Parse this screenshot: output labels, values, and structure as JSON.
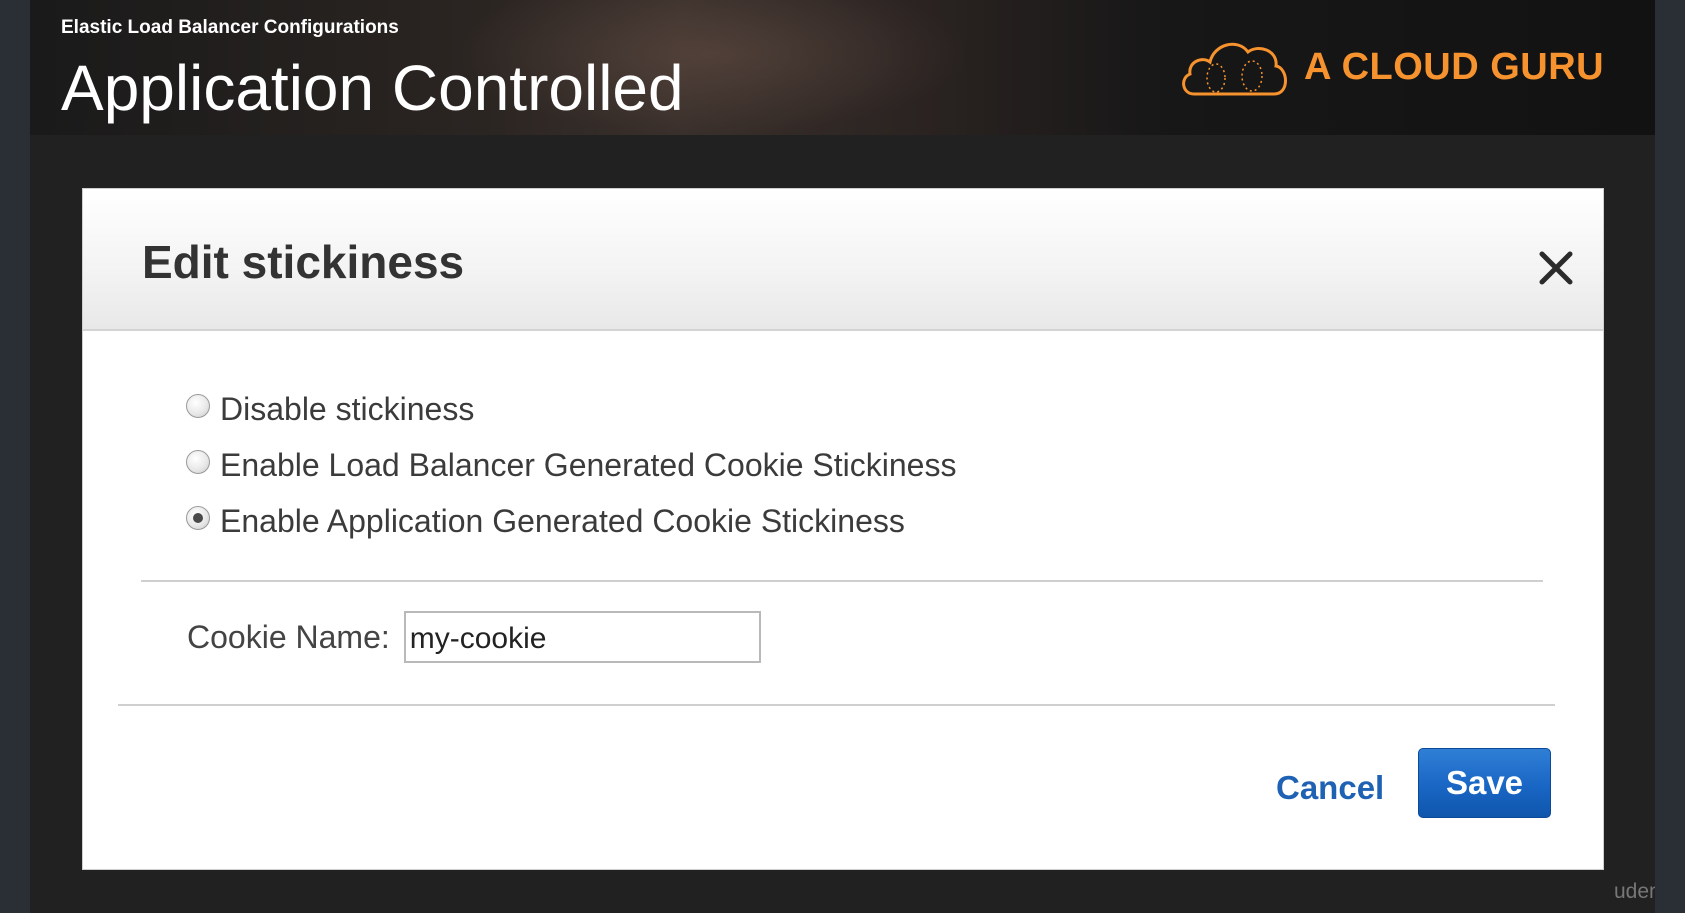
{
  "slide": {
    "section": "Elastic Load Balancer Configurations",
    "title": "Application Controlled",
    "brand": "A CLOUD GURU",
    "brand_color": "#f7932e",
    "watermark": "udemy"
  },
  "dialog": {
    "title": "Edit stickiness",
    "close_icon": "close-icon",
    "options": [
      {
        "label": "Disable stickiness",
        "selected": false
      },
      {
        "label": "Enable Load Balancer Generated Cookie Stickiness",
        "selected": false
      },
      {
        "label": "Enable Application Generated Cookie Stickiness",
        "selected": true
      }
    ],
    "cookie_label": "Cookie Name:",
    "cookie_value": "my-cookie",
    "cancel_label": "Cancel",
    "save_label": "Save",
    "accent_color": "#1966c4"
  }
}
